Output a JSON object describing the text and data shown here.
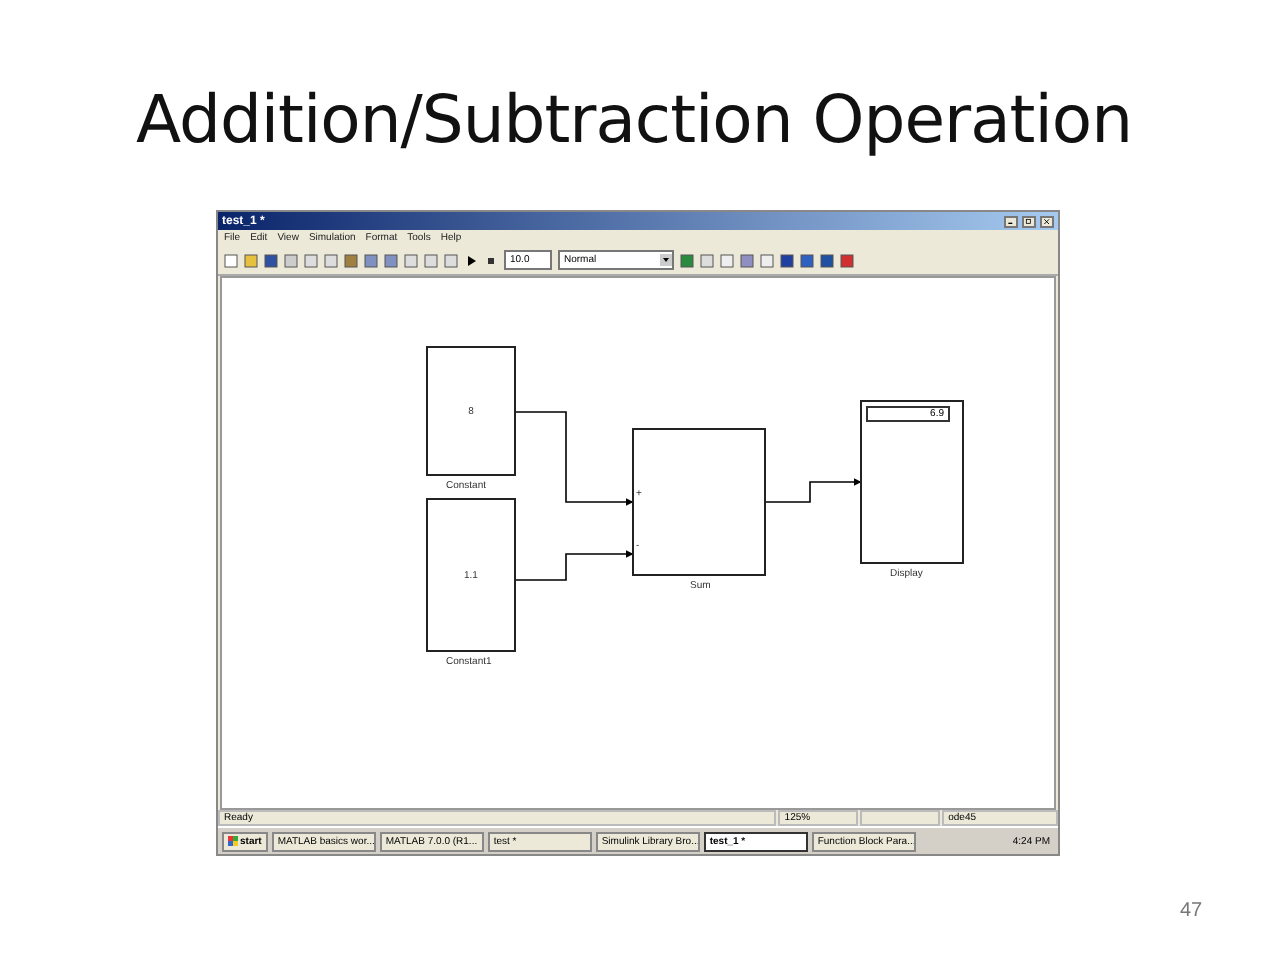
{
  "slide": {
    "title": "Addition/Subtraction Operation",
    "page_number": "47"
  },
  "window": {
    "title": "test_1 *",
    "menu": [
      "File",
      "Edit",
      "View",
      "Simulation",
      "Format",
      "Tools",
      "Help"
    ],
    "toolbar": {
      "stop_time": "10.0",
      "mode": "Normal"
    },
    "constants": [
      {
        "value": "8",
        "label": "Constant"
      },
      {
        "value": "1.1",
        "label": "Constant1"
      }
    ],
    "sum": {
      "label": "Sum",
      "signs": [
        "+",
        "-"
      ]
    },
    "display": {
      "value": "6.9",
      "label": "Display"
    },
    "status_bar": [
      "Ready",
      "125%",
      "ode45"
    ]
  },
  "taskbar": {
    "start": "start",
    "items": [
      {
        "label": "MATLAB basics wor...",
        "selected": false
      },
      {
        "label": "MATLAB 7.0.0 (R1...",
        "selected": false
      },
      {
        "label": "test *",
        "selected": false
      },
      {
        "label": "Simulink Library Bro...",
        "selected": false
      },
      {
        "label": "test_1 *",
        "selected": true
      },
      {
        "label": "Function Block Para...",
        "selected": false
      }
    ],
    "clock": "4:24 PM"
  }
}
